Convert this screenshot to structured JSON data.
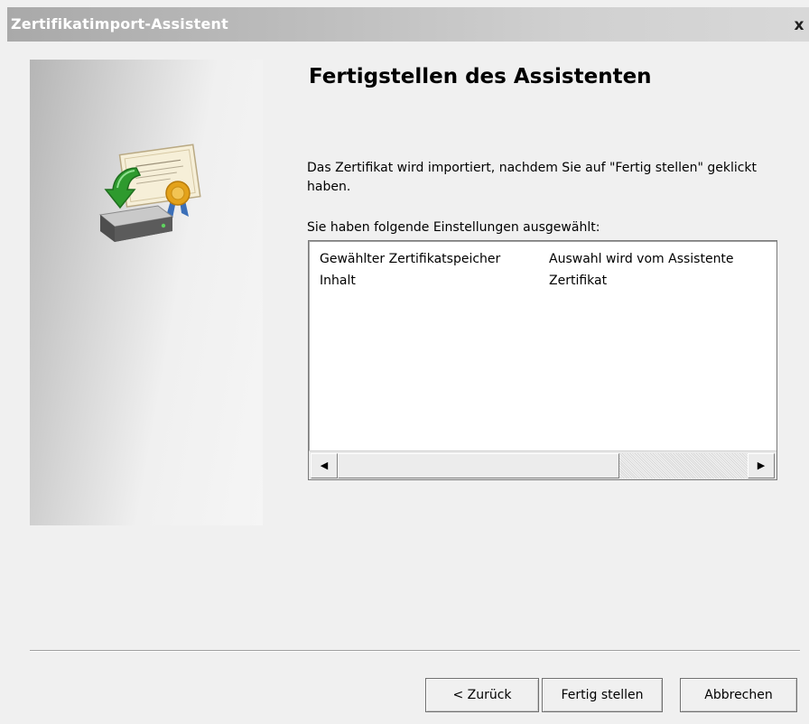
{
  "window": {
    "title": "Zertifikatimport-Assistent",
    "close_label": "x"
  },
  "main": {
    "heading": "Fertigstellen des Assistenten",
    "description": "Das Zertifikat wird importiert, nachdem Sie auf \"Fertig stellen\" geklickt haben.",
    "settings_label": "Sie haben folgende Einstellungen ausgewählt:",
    "settings_rows": [
      {
        "key": "Gewählter Zertifikatspeicher",
        "value": "Auswahl wird vom Assistente"
      },
      {
        "key": "Inhalt",
        "value": "Zertifikat"
      }
    ],
    "scroll_left_icon": "arrow-left-icon",
    "scroll_right_icon": "arrow-right-icon"
  },
  "buttons": {
    "back": "< Zurück",
    "finish": "Fertig stellen",
    "cancel": "Abbrechen"
  },
  "colors": {
    "title_bar": "#b8b8b8",
    "window_bg": "#f0f0f0",
    "arrow_green": "#2e9a2e",
    "seal_gold": "#e3a21a"
  }
}
